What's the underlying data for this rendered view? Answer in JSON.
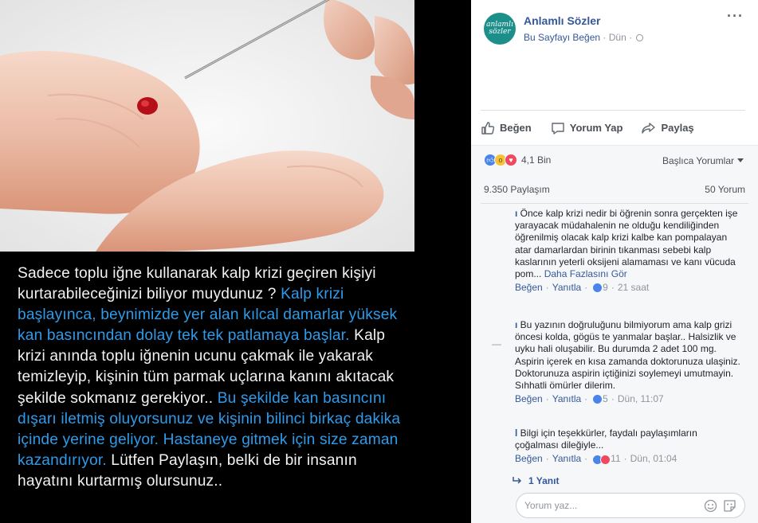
{
  "caption": [
    {
      "text": "Sadece toplu iğne kullanarak kalp krizi geçiren kişiyi kurtarabileceğinizi biliyor muydunuz ?",
      "color": "white"
    },
    {
      "text": " Kalp krizi başlayınca, beynimizde yer alan kılcal damarlar yüksek kan basıncından dolay tek tek patlamaya başlar.",
      "color": "blue"
    },
    {
      "text": " Kalp krizi anında toplu iğnenin ucunu çakmak ile yakarak temizleyip, kişinin tüm parmak uçlarına kanını akıtacak şekilde sokmanız gerekiyor..",
      "color": "white"
    },
    {
      "text": " Bu şekilde kan basıncını dışarı iletmiş oluyorsunuz ve kişinin bilinci birkaç dakika içinde yerine geliyor. Hastaneye gitmek için size zaman kazandırıyor.",
      "color": "blue"
    },
    {
      "text": " Lütfen Paylaşın, belki de bir insanın hayatını kurtarmış olursunuz..",
      "color": "white"
    }
  ],
  "post": {
    "avatar_text_1": "anlamlı",
    "avatar_text_2": "sözler",
    "page_name": "Anlamlı Sözler",
    "like_page": "Bu Sayfayı Beğen",
    "time": "Dün",
    "more": "···"
  },
  "actions": {
    "like": "Beğen",
    "comment": "Yorum Yap",
    "share": "Paylaş"
  },
  "reactions": {
    "count": "4,1 Bin",
    "sort_label": "Başlıca Yorumlar",
    "shares": "9.350 Paylaşım",
    "comments": "50 Yorum"
  },
  "comments": [
    {
      "author": "ı",
      "text": " Önce kalp krizi nedir bi öğrenin sonra gerçekten işe yarayacak müdahalenin ne olduğu kendiliğinden öğrenilmiş olacak kalp krizi kalbe kan pompalayan atar damarlardan birinin tıkanması sebebi kalp kaslarının yeterli oksijeni alamaması ve kanı vücuda pom...",
      "see_more": "Daha Fazlasını Gör",
      "like": "Beğen",
      "reply": "Yanıtla",
      "reaction_count": "9",
      "time": "21 saat"
    },
    {
      "author": "ı",
      "text": " Bu yazının doğruluğunu bilmiyorum ama kalp grizi öncesi kolda, gögüs te yanmalar başlar.. Halsizlik ve uyku hali oluşabilir. Bu durumda 2 adet 100 mg. Aspirin içerek en kısa zamanda doktorunuza ulaşiniz. Doktorunuza aspirin içtiğinizi soylemeyi umutmayin. Sıhhatli ömürler dilerim.",
      "like": "Beğen",
      "reply": "Yanıtla",
      "reaction_count": "5",
      "time": "Dün, 11:07"
    },
    {
      "author": "l",
      "text": " Bilgi için teşekkürler, faydalı paylaşımların çoğalması dileğiyle...",
      "like": "Beğen",
      "reply": "Yanıtla",
      "reaction_count": "11",
      "time": "Dün, 01:04"
    }
  ],
  "replies_label": "1 Yanıt",
  "composer": {
    "placeholder": "Yorum yaz..."
  },
  "colors": {
    "link": "#365899",
    "caption_blue": "#2e9bea",
    "caption_white": "#f2f2f2"
  }
}
